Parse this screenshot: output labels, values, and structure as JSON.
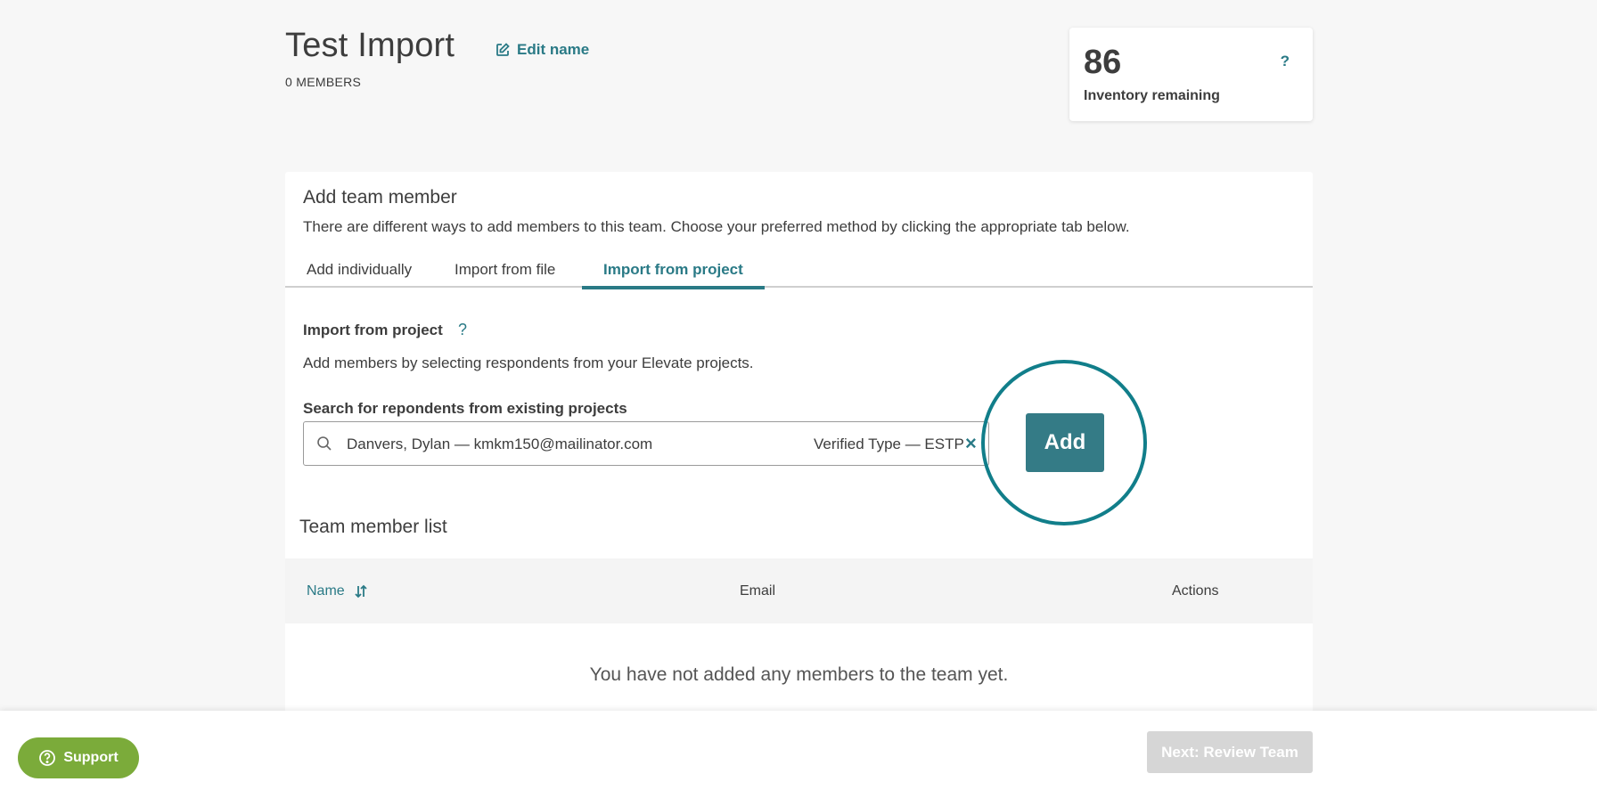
{
  "header": {
    "title": "Test Import",
    "edit_label": "Edit name",
    "members_count": "0 MEMBERS"
  },
  "inventory": {
    "number": "86",
    "label": "Inventory remaining",
    "help": "?"
  },
  "add_member": {
    "title": "Add team member",
    "description": "There are different ways to add members to this team. Choose your preferred method by clicking the appropriate tab below.",
    "tabs": [
      {
        "label": "Add individually"
      },
      {
        "label": "Import from file"
      },
      {
        "label": "Import from project"
      }
    ],
    "active_tab": "Import from project"
  },
  "import_project": {
    "title": "Import from project",
    "help": "?",
    "description": "Add members by selecting respondents from your Elevate projects.",
    "search_label": "Search for repondents from existing projects",
    "search_value": "Danvers, Dylan — kmkm150@mailinator.com",
    "verified_type": "Verified Type — ESTP",
    "clear": "×",
    "add_label": "Add"
  },
  "team_list": {
    "title": "Team member list",
    "columns": [
      "Name",
      "Email",
      "Actions"
    ],
    "empty_message": "You have not added any members to the team yet."
  },
  "footer": {
    "support_label": "Support",
    "next_label": "Next: Review Team"
  },
  "colors": {
    "accent": "#2a7a86",
    "support": "#7bab3a",
    "disabled": "#d6d6d6"
  }
}
